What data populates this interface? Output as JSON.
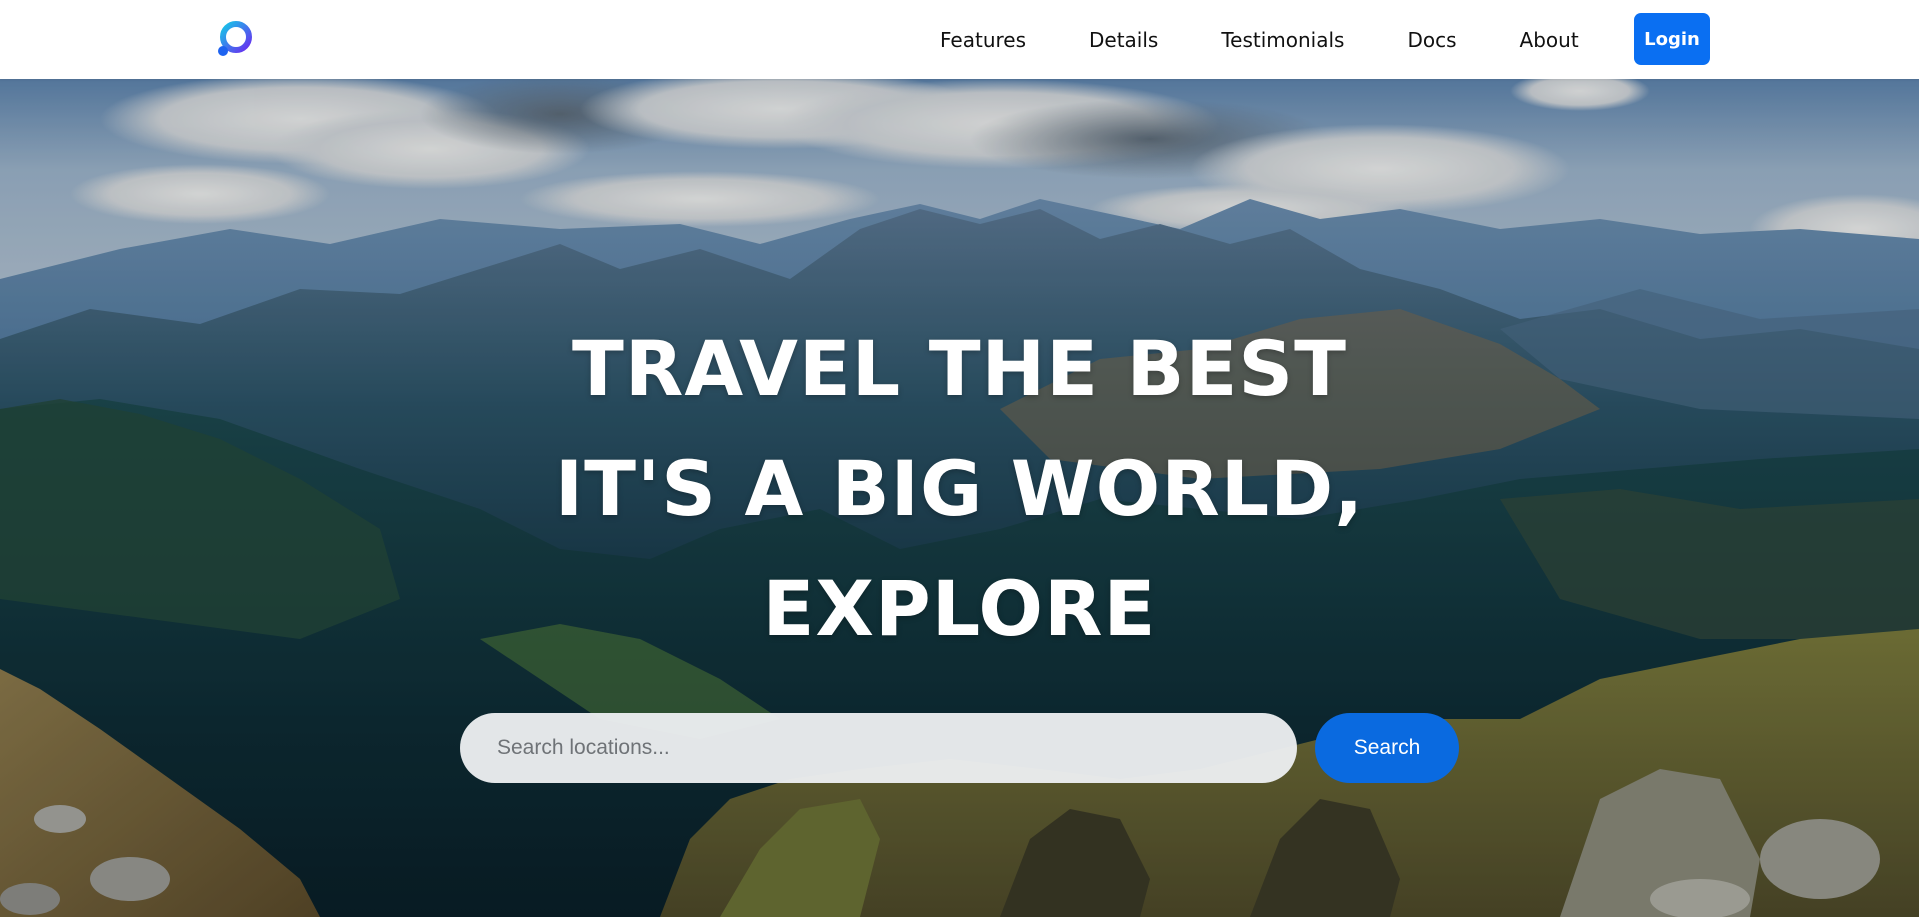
{
  "header": {
    "logo_icon": "ring-logo-icon",
    "nav": [
      {
        "label": "Features"
      },
      {
        "label": "Details"
      },
      {
        "label": "Testimonials"
      },
      {
        "label": "Docs"
      },
      {
        "label": "About"
      }
    ],
    "login_label": "Login",
    "accent_color": "#0a6ff2"
  },
  "hero": {
    "title_lines": [
      "TRAVEL THE BEST",
      "IT'S A BIG WORLD,",
      "EXPLORE"
    ],
    "search": {
      "placeholder": "Search locations...",
      "value": "",
      "button_label": "Search"
    }
  }
}
